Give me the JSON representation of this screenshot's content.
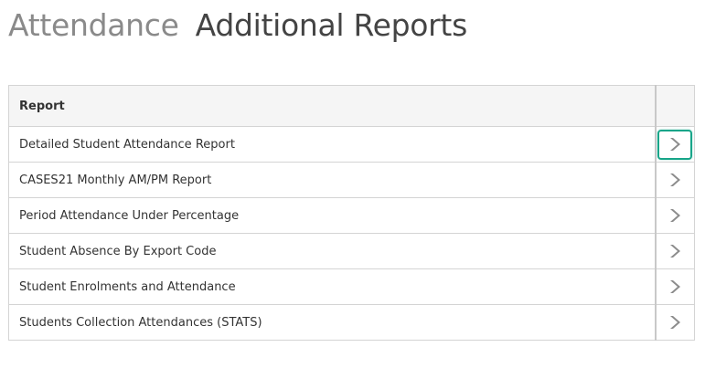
{
  "header": {
    "title_main": "Attendance",
    "title_sub": "Additional Reports"
  },
  "table": {
    "column_header": "Report",
    "rows": [
      {
        "label": "Detailed Student Attendance Report",
        "focused": true
      },
      {
        "label": "CASES21 Monthly AM/PM Report",
        "focused": false
      },
      {
        "label": "Period Attendance Under Percentage",
        "focused": false
      },
      {
        "label": "Student Absence By Export Code",
        "focused": false
      },
      {
        "label": "Student Enrolments and Attendance",
        "focused": false
      },
      {
        "label": "Students Collection Attendances (STATS)",
        "focused": false
      }
    ]
  },
  "icons": {
    "row_action": "chevron-right-icon"
  },
  "colors": {
    "focus_ring": "#17a589",
    "chevron": "#8c8c8c",
    "border": "#d4d4d4",
    "header_bg": "#f5f5f5"
  }
}
